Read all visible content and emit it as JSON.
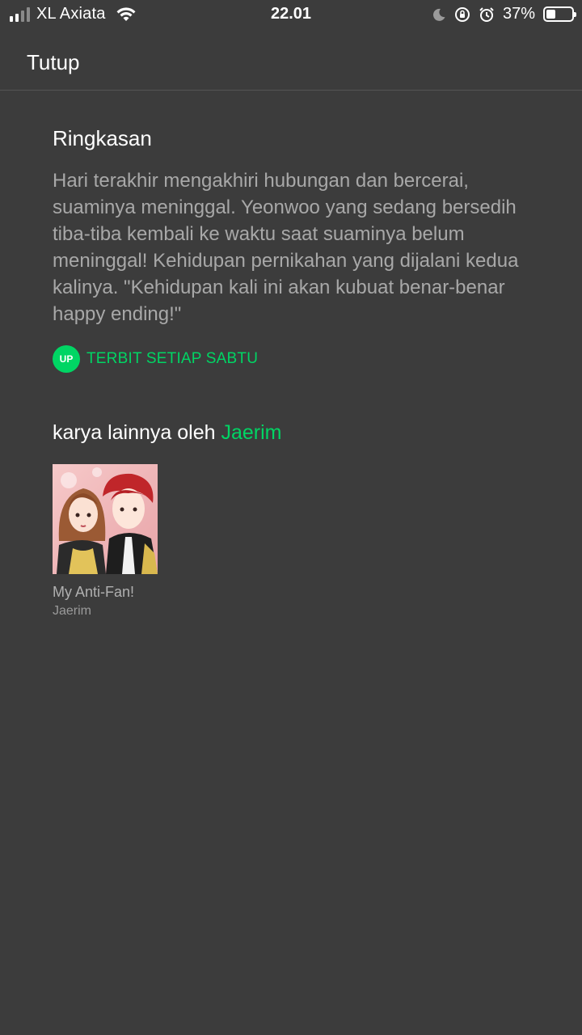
{
  "status_bar": {
    "carrier": "XL Axiata",
    "time": "22.01",
    "battery_percent": "37%",
    "battery_level": 0.37,
    "icons": [
      "signal-icon",
      "wifi-icon",
      "moon-icon",
      "rotation-lock-icon",
      "alarm-icon",
      "battery-icon"
    ]
  },
  "header": {
    "close_label": "Tutup"
  },
  "summary": {
    "title": "Ringkasan",
    "text": "Hari terakhir mengakhiri hubungan dan bercerai, suaminya meninggal. Yeonwoo yang sedang bersedih tiba-tiba kembali ke waktu saat suaminya belum meninggal! Kehidupan pernikahan yang dijalani kedua kalinya. \"Kehidupan kali ini akan kubuat benar-benar happy ending!\"",
    "badge": "UP",
    "schedule": "TERBIT SETIAP SABTU"
  },
  "other_works": {
    "prefix": "karya lainnya oleh",
    "author": "Jaerim",
    "items": [
      {
        "title": "My Anti-Fan!",
        "author": "Jaerim"
      }
    ]
  },
  "colors": {
    "background": "#3c3c3c",
    "accent": "#00d564",
    "muted_text": "#a8a8a8"
  }
}
